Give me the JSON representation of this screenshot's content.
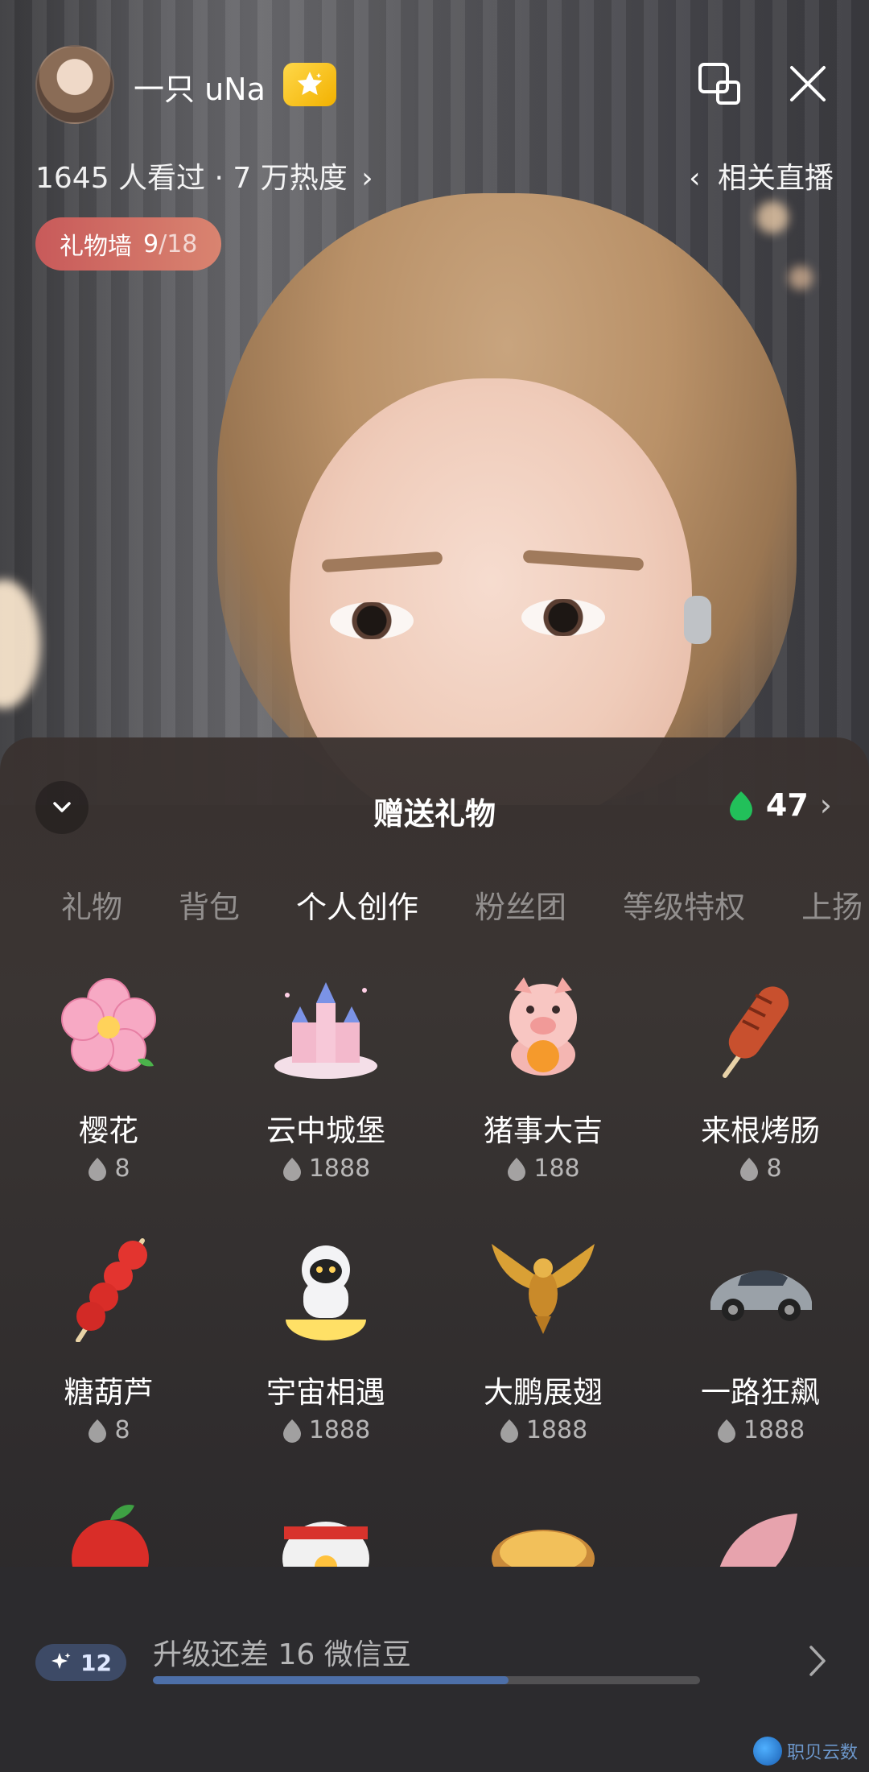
{
  "header": {
    "host_name": "一只 uNa",
    "stats_text": "1645 人看过 · 7 万热度",
    "related_label": "相关直播",
    "gift_wall_label": "礼物墙",
    "gift_wall_count": "9",
    "gift_wall_total": "/18"
  },
  "panel": {
    "title": "赠送礼物",
    "balance": "47",
    "tabs": [
      {
        "label": "礼物",
        "active": false
      },
      {
        "label": "背包",
        "active": false
      },
      {
        "label": "个人创作",
        "active": true
      },
      {
        "label": "粉丝团",
        "active": false
      },
      {
        "label": "等级特权",
        "active": false
      },
      {
        "label": "上扬",
        "active": false
      }
    ],
    "gifts": [
      {
        "name": "樱花",
        "price": "8",
        "icon": "cherry-blossom-icon"
      },
      {
        "name": "云中城堡",
        "price": "1888",
        "icon": "castle-icon"
      },
      {
        "name": "猪事大吉",
        "price": "188",
        "icon": "pig-icon"
      },
      {
        "name": "来根烤肠",
        "price": "8",
        "icon": "sausage-icon"
      },
      {
        "name": "糖葫芦",
        "price": "8",
        "icon": "candied-haws-icon"
      },
      {
        "name": "宇宙相遇",
        "price": "1888",
        "icon": "astronaut-icon"
      },
      {
        "name": "大鹏展翅",
        "price": "1888",
        "icon": "eagle-icon"
      },
      {
        "name": "一路狂飙",
        "price": "1888",
        "icon": "sports-car-icon"
      }
    ],
    "partial_gifts": [
      {
        "icon": "apple-icon"
      },
      {
        "icon": "rice-ball-icon"
      },
      {
        "icon": "egg-tart-icon"
      },
      {
        "icon": "pink-treat-icon"
      }
    ]
  },
  "level": {
    "badge_value": "12",
    "upgrade_text": "升级还差 16 微信豆",
    "progress": 0.65
  },
  "watermark": "职贝云数",
  "colors": {
    "bean_green": "#22c05a",
    "gift_wall_start": "#c85a5a",
    "progress_fill": "#4d6fa8"
  }
}
